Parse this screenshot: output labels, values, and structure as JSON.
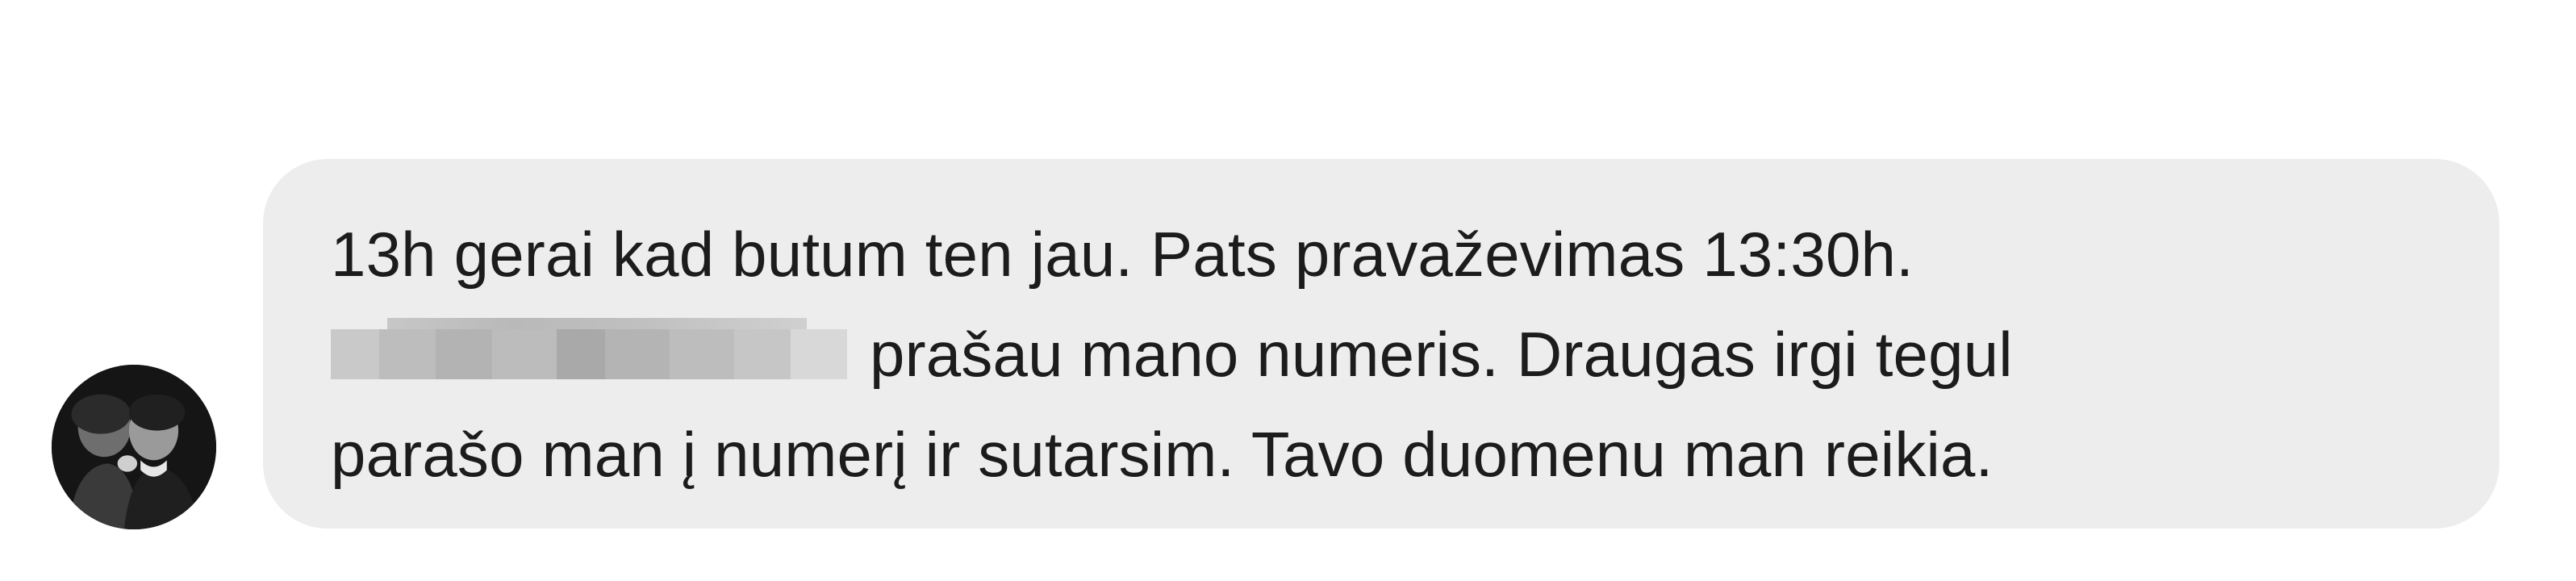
{
  "sender": {
    "avatar_icon": "profile-photo-avatar"
  },
  "message": {
    "line1": "13h gerai kad butum ten jau. Pats pravaževimas 13:30h.",
    "line2": "prašau mano numeris. Draugas irgi tegul",
    "line3": "parašo man į numerį ir sutarsim. Tavo duomenu man reikia.",
    "redacted_icon": "redacted-phone-number"
  },
  "colors": {
    "bubble_bg": "#eeedee",
    "text": "#1c1c1c"
  }
}
